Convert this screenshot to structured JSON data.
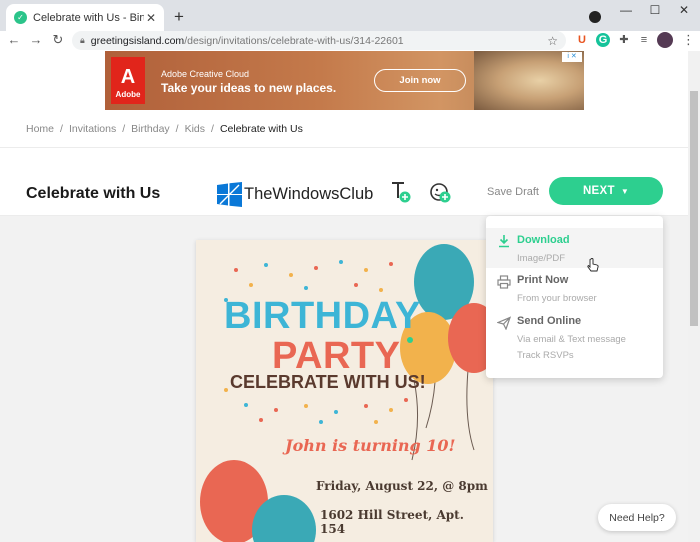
{
  "browser": {
    "tab_title": "Celebrate with Us - Birthday Invi",
    "tab_close": "✕",
    "new_tab": "+",
    "url_host": "greetingsisland.com",
    "url_path": "/design/invitations/celebrate-with-us/314-22601",
    "back_icon": "←",
    "forward_icon": "→",
    "reload_icon": "↻",
    "star_icon": "☆",
    "minimize": "—",
    "maximize": "☐",
    "close": "✕",
    "menu_icon": "⋮",
    "ext_u": "U",
    "ext_g": "G"
  },
  "ad": {
    "brand": "Adobe",
    "logo_glyph": "A",
    "title": "Adobe Creative Cloud",
    "tagline": "Take your ideas to new places.",
    "cta": "Join now",
    "adchoices": "i ✕"
  },
  "breadcrumb": {
    "items": [
      "Home",
      "Invitations",
      "Birthday",
      "Kids"
    ],
    "current": "Celebrate with Us",
    "separator": "/"
  },
  "header": {
    "title": "Celebrate with Us",
    "watermark": "TheWindowsClub",
    "save_draft": "Save Draft",
    "next_label": "NEXT",
    "next_chevron": "⌄"
  },
  "card": {
    "line1": "BIRTHDAY",
    "line2": "PARTY",
    "line3": "CELEBRATE WITH US!",
    "line4": "John is turning 10!",
    "line5": "Friday, August 22, @ 8pm",
    "line6": "1602 Hill Street, Apt. 154"
  },
  "dropdown": {
    "items": [
      {
        "label": "Download",
        "sub": "Image/PDF",
        "icon": "download-icon"
      },
      {
        "label": "Print Now",
        "sub": "From your browser",
        "icon": "printer-icon"
      },
      {
        "label": "Send Online",
        "sub": "Via email & Text message",
        "sub2": "Track RSVPs",
        "icon": "send-icon"
      }
    ]
  },
  "help": {
    "label": "Need Help?"
  },
  "colors": {
    "accent": "#2dcf8f",
    "balloon_teal": "#3aa9b6",
    "balloon_orange": "#f2b24c",
    "balloon_red": "#e96753"
  }
}
